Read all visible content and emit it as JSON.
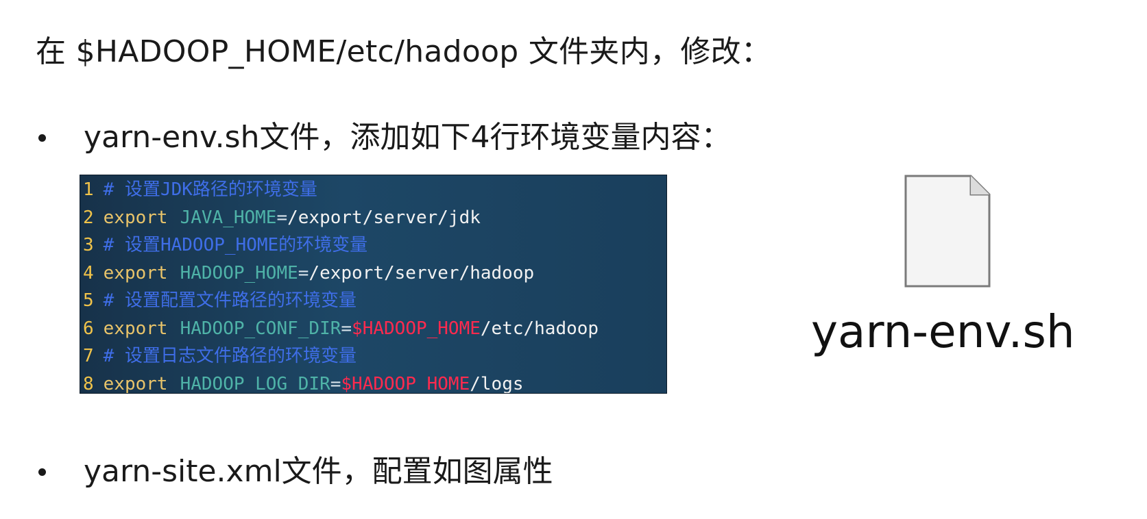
{
  "heading": "在 $HADOOP_HOME/etc/hadoop 文件夹内，修改：",
  "bullets": [
    "yarn-env.sh文件，添加如下4行环境变量内容：",
    "yarn-site.xml文件，配置如图属性"
  ],
  "code": {
    "lines": [
      {
        "num": "1",
        "comment": "# 设置JDK路径的环境变量"
      },
      {
        "num": "2",
        "keyword": "export",
        "var": "JAVA_HOME",
        "eq": "=",
        "path": "/export/server/jdk"
      },
      {
        "num": "3",
        "comment": "# 设置HADOOP_HOME的环境变量"
      },
      {
        "num": "4",
        "keyword": "export",
        "var": "HADOOP_HOME",
        "eq": "=",
        "path": "/export/server/hadoop"
      },
      {
        "num": "5",
        "comment": "# 设置配置文件路径的环境变量"
      },
      {
        "num": "6",
        "keyword": "export",
        "var": "HADOOP_CONF_DIR",
        "eq": "=",
        "ref": "$HADOOP_HOME",
        "path": "/etc/hadoop"
      },
      {
        "num": "7",
        "comment": "# 设置日志文件路径的环境变量"
      },
      {
        "num": "8",
        "keyword": "export",
        "var": "HADOOP_LOG_DIR",
        "eq": "=",
        "ref": "$HADOOP_HOME",
        "path": "/logs"
      }
    ]
  },
  "file_icon": {
    "icon": "file-icon",
    "label": "yarn-env.sh"
  },
  "colors": {
    "code_background": "#1d4766",
    "line_number": "#f0c34a",
    "comment": "#3f6ee8",
    "keyword": "#e9c46a",
    "variable": "#4fb3a8",
    "reference": "#ff2a4e",
    "path": "#f2f2f2"
  }
}
